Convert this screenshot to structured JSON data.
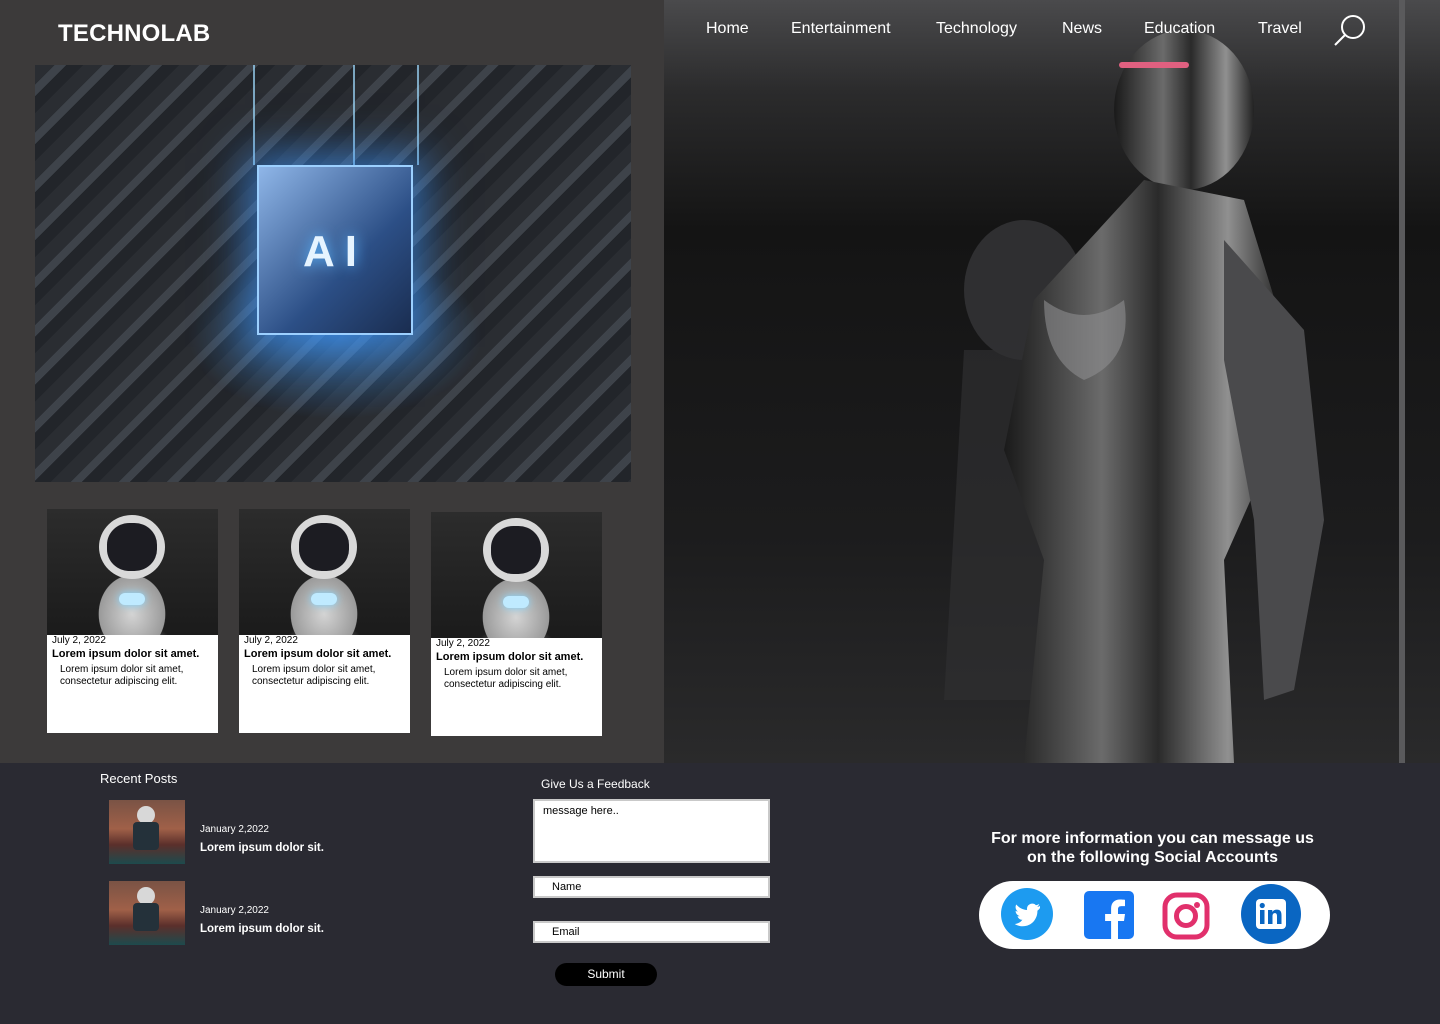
{
  "brand": {
    "name": "TECHNOLAB"
  },
  "nav": {
    "items": [
      "Home",
      "Entertainment",
      "Technology",
      "News",
      "Education",
      "Travel"
    ],
    "search_icon": "search-icon"
  },
  "featured": {
    "image_label": "AI"
  },
  "cards": [
    {
      "date": "July 2, 2022",
      "title": "Lorem ipsum dolor sit amet.",
      "text": "Lorem ipsum dolor sit amet, consectetur adipiscing elit."
    },
    {
      "date": "July 2, 2022",
      "title": "Lorem ipsum dolor sit amet.",
      "text": "Lorem ipsum dolor sit amet, consectetur adipiscing elit."
    },
    {
      "date": "July 2, 2022",
      "title": "Lorem ipsum dolor sit amet.",
      "text": "Lorem ipsum dolor sit amet, consectetur adipiscing elit."
    }
  ],
  "recent": {
    "title": "Recent Posts",
    "posts": [
      {
        "date": "January 2,2022",
        "title": "Lorem ipsum dolor sit."
      },
      {
        "date": "January 2,2022",
        "title": "Lorem ipsum dolor sit."
      }
    ]
  },
  "feedback": {
    "title": "Give Us a Feedback",
    "message_placeholder": "message here..",
    "name_placeholder": "Name",
    "email_placeholder": "Email",
    "submit_label": "Submit"
  },
  "social": {
    "heading_line1": "For more information you can message us",
    "heading_line2": "on the following Social Accounts",
    "icons": [
      "twitter-icon",
      "facebook-icon",
      "instagram-icon",
      "linkedin-icon"
    ],
    "colors": {
      "twitter": "#1d9bf0",
      "facebook": "#1877f2",
      "instagram": "#e1306c",
      "linkedin": "#0a66c2"
    }
  },
  "theme": {
    "panel": "#3c3a3a",
    "footer": "#2a2a32",
    "text": "#ffffff"
  }
}
